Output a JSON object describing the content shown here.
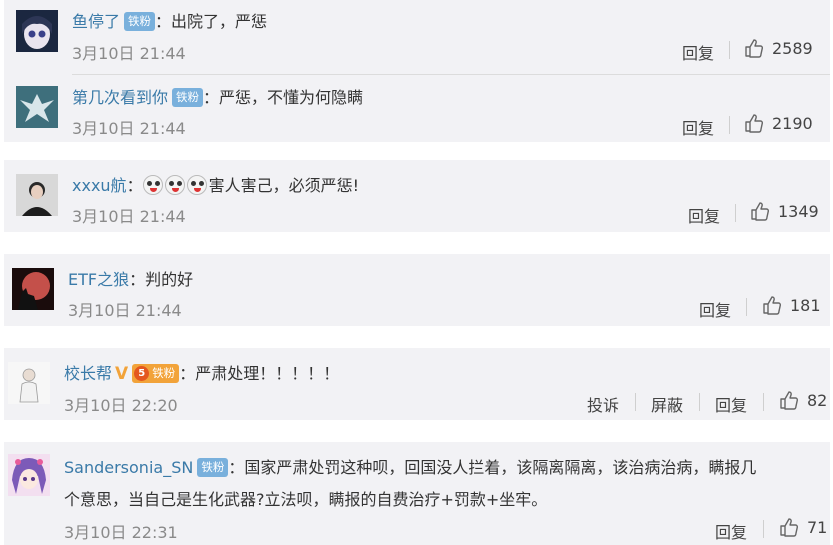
{
  "comments": [
    {
      "username": "鱼停了",
      "badge": "铁粉",
      "text": "出院了，严惩",
      "time": "3月10日 21:44",
      "reply_label": "回复",
      "likes": "2589"
    },
    {
      "username": "第几次看到你",
      "badge": "铁粉",
      "text": "严惩，不懂为何隐瞒",
      "time": "3月10日 21:44",
      "reply_label": "回复",
      "likes": "2190"
    },
    {
      "username": "xxxu航",
      "text": "害人害己，必须严惩!",
      "time": "3月10日 21:44",
      "reply_label": "回复",
      "likes": "1349"
    },
    {
      "username": "ETF之狼",
      "text": "判的好",
      "time": "3月10日 21:44",
      "reply_label": "回复",
      "likes": "181"
    },
    {
      "username": "校长帮",
      "badge_level": "5",
      "badge": "铁粉",
      "text": "严肃处理！！！！！",
      "time": "3月10日 22:20",
      "report_label": "投诉",
      "block_label": "屏蔽",
      "reply_label": "回复",
      "likes": "82"
    },
    {
      "username": "Sandersonia_SN",
      "badge": "铁粉",
      "text_line1": "国家严肃处罚这种呗，回国没人拦着，该隔离隔离，该治病治病，瞒报几",
      "text_line2": "个意思，当自己是生化武器?立法呗，瞒报的自费治疗+罚款+坐牢。",
      "time": "3月10日 22:31",
      "reply_label": "回复",
      "likes": "71"
    }
  ],
  "colors": {
    "card_bg": "#f2f2f5",
    "username": "#3a7aa8",
    "badge": "#79b0dc",
    "time": "#8a8a8a"
  }
}
